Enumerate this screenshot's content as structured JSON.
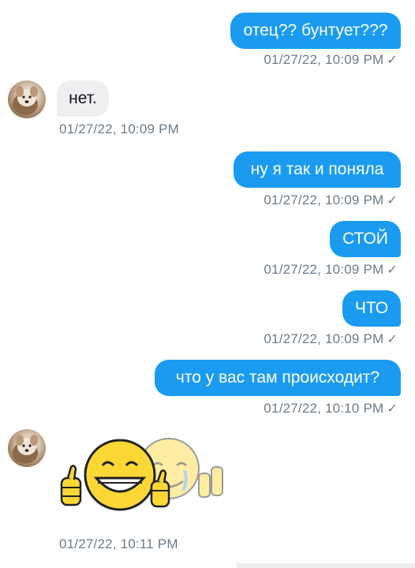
{
  "messages": [
    {
      "text": "отец?? бунтует???",
      "time": "01/27/22, 10:09 PM",
      "status": "✓"
    },
    {
      "text": "нет.",
      "time": "01/27/22, 10:09 PM"
    },
    {
      "text": "ну я так и поняла",
      "time": "01/27/22, 10:09 PM",
      "status": "✓"
    },
    {
      "text": "СТОЙ",
      "time": "01/27/22, 10:09 PM",
      "status": "✓"
    },
    {
      "text": "ЧТО",
      "time": "01/27/22, 10:09 PM",
      "status": "✓"
    },
    {
      "text": "что у вас там происходит?",
      "time": "01/27/22, 10:10 PM",
      "status": "✓"
    },
    {
      "time": "01/27/22, 10:11 PM"
    }
  ],
  "icons": {
    "avatar": "avatar-dog-photo",
    "sticker": "laughing-crying-emoji-sticker",
    "read_receipt": "checkmark-icon"
  },
  "colors": {
    "outgoing_bubble": "#1a9bf0",
    "incoming_bubble": "#efeff2",
    "timestamp": "#6e7b88",
    "sticker_yellow": "#fdd835"
  }
}
